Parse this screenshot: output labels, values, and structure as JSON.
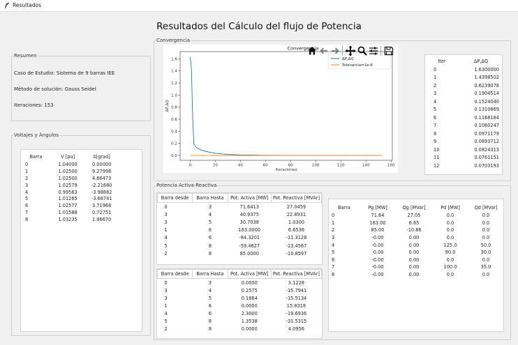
{
  "window": {
    "title": "Resultados"
  },
  "main_title": "Resultados del Cálculo del flujo de Potencia",
  "resumen": {
    "legend": "Resumen",
    "caso": "Caso de Estudio:  Sistema de 9 barras IEE",
    "metodo": "Método de solución:  Gauss Seidel",
    "iteraciones": "Iteraciones: 153"
  },
  "voltajes": {
    "legend": "Voltajes y Ángulos",
    "columns": [
      "Barra",
      "V [pu]",
      "δ[grad]"
    ],
    "rows": [
      [
        "0",
        "1.04000",
        "0.00000"
      ],
      [
        "1",
        "1.02500",
        "9.27998"
      ],
      [
        "2",
        "1.02500",
        "4.66473"
      ],
      [
        "3",
        "1.02579",
        "-2.21680"
      ],
      [
        "4",
        "0.99563",
        "-3.98882"
      ],
      [
        "5",
        "1.01265",
        "-3.68741"
      ],
      [
        "6",
        "1.02577",
        "3.71968"
      ],
      [
        "7",
        "1.01588",
        "0.72751"
      ],
      [
        "8",
        "1.03235",
        "1.96670"
      ]
    ]
  },
  "convergencia": {
    "legend": "Convergencia",
    "toolbar_icons": [
      "home-icon",
      "back-arrow-icon",
      "forward-arrow-icon",
      "pan-icon",
      "zoom-icon",
      "configure-subplots-icon",
      "save-icon"
    ],
    "table": {
      "columns": [
        "Iter",
        "ΔP,ΔQ"
      ],
      "rows": [
        [
          "0",
          "1.6300000"
        ],
        [
          "1",
          "1.4398502"
        ],
        [
          "2",
          "0.6239078"
        ],
        [
          "3",
          "0.1904514"
        ],
        [
          "4",
          "0.1524040"
        ],
        [
          "5",
          "0.1310869"
        ],
        [
          "6",
          "0.1168184"
        ],
        [
          "7",
          "0.1060247"
        ],
        [
          "8",
          "0.0971179"
        ],
        [
          "9",
          "0.0893712"
        ],
        [
          "10",
          "0.0824313"
        ],
        [
          "11",
          "0.0761151"
        ],
        [
          "12",
          "0.0703193"
        ]
      ]
    }
  },
  "potencia": {
    "legend": "Potencia Activa-Reactiva",
    "flows_columns": [
      "Barra desde",
      "Barra Hasta",
      "Pot. Activa [MW]",
      "Pot. Reactiva [MVAr]"
    ],
    "flows_forward": [
      [
        "0",
        "3",
        "71.6413",
        "27.0459"
      ],
      [
        "3",
        "4",
        "40.9375",
        "22.8931"
      ],
      [
        "3",
        "5",
        "30.7038",
        "1.0300"
      ],
      [
        "1",
        "6",
        "163.0000",
        "6.6536"
      ],
      [
        "4",
        "6",
        "-84.3201",
        "-11.3128"
      ],
      [
        "5",
        "8",
        "-59.4627",
        "-13.4567"
      ],
      [
        "2",
        "8",
        "85.0000",
        "-10.8597"
      ]
    ],
    "flows_losses": [
      [
        "0",
        "3",
        "0.0000",
        "3.1228"
      ],
      [
        "3",
        "4",
        "0.2575",
        "-15.7941"
      ],
      [
        "3",
        "5",
        "0.1664",
        "-15.5134"
      ],
      [
        "1",
        "6",
        "0.0000",
        "15.8318"
      ],
      [
        "4",
        "6",
        "2.3000",
        "-19.6936"
      ],
      [
        "5",
        "8",
        "1.3538",
        "-31.5315"
      ],
      [
        "2",
        "8",
        "0.0000",
        "4.0956"
      ]
    ],
    "bus_columns": [
      "Barra",
      "Pg [MW]",
      "Qg [MVar]",
      "Pd [MW]",
      "Qd [MVar]"
    ],
    "bus_rows": [
      [
        "0",
        "71.64",
        "27.05",
        "0.0",
        "0.0"
      ],
      [
        "1",
        "163.00",
        "6.65",
        "0.0",
        "0.0"
      ],
      [
        "2",
        "85.00",
        "-10.86",
        "0.0",
        "0.0"
      ],
      [
        "3",
        "-0.00",
        "0.00",
        "0.0",
        "0.0"
      ],
      [
        "4",
        "-0.00",
        "0.00",
        "125.0",
        "50.0"
      ],
      [
        "5",
        "-0.00",
        "0.00",
        "90.0",
        "30.0"
      ],
      [
        "6",
        "-0.00",
        "0.00",
        "0.0",
        "0.0"
      ],
      [
        "7",
        "-0.00",
        "0.00",
        "100.0",
        "35.0"
      ],
      [
        "8",
        "-0.00",
        "0.00",
        "0.0",
        "0.0"
      ]
    ]
  },
  "chart_data": {
    "type": "line",
    "title": "Convergencia",
    "xlabel": "Iteraciones",
    "ylabel": "ΔP,ΔQ",
    "xlim": [
      -8,
      161
    ],
    "ylim": [
      -0.08,
      1.72
    ],
    "xticks": [
      0,
      20,
      40,
      60,
      80,
      100,
      120,
      140,
      160
    ],
    "yticks": [
      0.0,
      0.2,
      0.4,
      0.6,
      0.8,
      1.0,
      1.2,
      1.4,
      1.6
    ],
    "legend_position": "upper-right",
    "grid": false,
    "series": [
      {
        "name": "ΔP,ΔQ",
        "color": "#1f77b4",
        "x": [
          0,
          1,
          2,
          3,
          4,
          5,
          6,
          7,
          8,
          9,
          10,
          11,
          12,
          15,
          20,
          25,
          30,
          40,
          50,
          60,
          80,
          100,
          120,
          140,
          153
        ],
        "y": [
          1.63,
          1.4398502,
          0.6239078,
          0.1904514,
          0.152404,
          0.1310869,
          0.1168184,
          0.1060247,
          0.0971179,
          0.0893712,
          0.0824313,
          0.0761151,
          0.0703193,
          0.056,
          0.038,
          0.026,
          0.018,
          0.009,
          0.005,
          0.003,
          0.001,
          0.0005,
          0.0002,
          0.0001,
          1e-05
        ]
      },
      {
        "name": "Tolerancia=1e-6",
        "color": "#ff7f0e",
        "x": [
          0,
          153
        ],
        "y": [
          1e-06,
          1e-06
        ]
      }
    ]
  }
}
